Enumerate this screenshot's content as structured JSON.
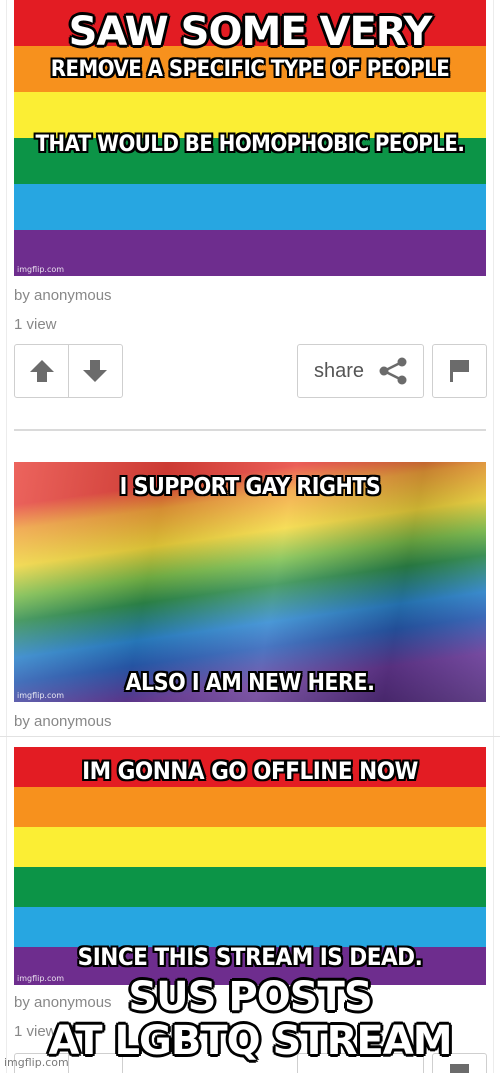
{
  "meme": {
    "top_caption": "SAW SOME VERY",
    "bottom_caption_line1": "SUS POSTS",
    "bottom_caption_line2": "AT LGBTQ STREAM",
    "watermark": "imgflip.com"
  },
  "posts": [
    {
      "image_text_top": "REMOVE A SPECIFIC TYPE OF PEOPLE",
      "image_text_bottom": "THAT WOULD BE HOMOPHOBIC PEOPLE.",
      "image_watermark": "imgflip.com",
      "author": "by anonymous",
      "views": "1 view",
      "share_label": "share"
    },
    {
      "image_text_top": "I SUPPORT GAY RIGHTS",
      "image_text_bottom": "ALSO I AM NEW HERE.",
      "image_watermark": "imgflip.com",
      "author": "by anonymous"
    },
    {
      "image_text_top": "IM GONNA GO OFFLINE NOW",
      "image_text_bottom": "SINCE THIS STREAM IS DEAD.",
      "image_watermark": "imgflip.com",
      "author": "by anonymous",
      "views": "1 view"
    }
  ],
  "icons": [
    "upvote-arrow-icon",
    "downvote-arrow-icon",
    "share-icon",
    "flag-icon"
  ],
  "colors": {
    "rainbow": [
      "#e31c23",
      "#f7911d",
      "#fbee34",
      "#0c9447",
      "#27a6e1",
      "#6e2d8e"
    ],
    "meta_text": "#888888",
    "button_border": "#cfcfcf",
    "icon_gray": "#6b6b6b"
  }
}
